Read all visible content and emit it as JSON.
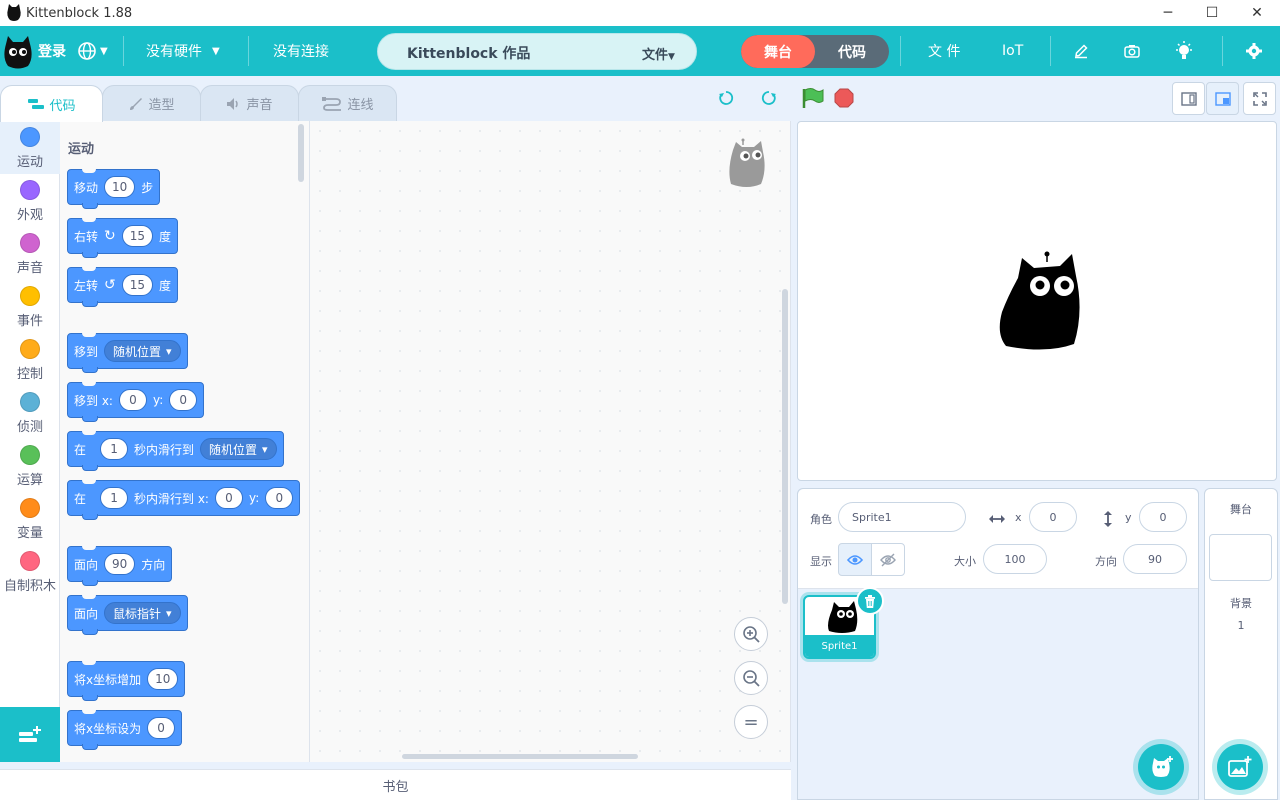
{
  "window": {
    "title": "Kittenblock 1.88",
    "minimize": "─",
    "maximize": "☐",
    "close": "✕"
  },
  "menubar": {
    "login": "登录",
    "hardware": "没有硬件",
    "connection": "没有连接",
    "project_title": "Kittenblock 作品",
    "file_dropdown": "文件",
    "mode_stage": "舞台",
    "mode_code": "代码",
    "file": "文 件",
    "iot": "IoT"
  },
  "tabs": {
    "code": "代码",
    "costume": "造型",
    "sound": "声音",
    "wiring": "连线"
  },
  "categories": [
    {
      "label": "运动",
      "color": "#4c97ff"
    },
    {
      "label": "外观",
      "color": "#9966ff"
    },
    {
      "label": "声音",
      "color": "#cf63cf"
    },
    {
      "label": "事件",
      "color": "#ffbf00"
    },
    {
      "label": "控制",
      "color": "#ffab19"
    },
    {
      "label": "侦测",
      "color": "#5cb1d6"
    },
    {
      "label": "运算",
      "color": "#59c059"
    },
    {
      "label": "变量",
      "color": "#ff8c1a"
    },
    {
      "label": "自制积木",
      "color": "#ff6680"
    }
  ],
  "palette": {
    "section_title": "运动",
    "move": {
      "label": "移动",
      "steps": "10",
      "unit": "步"
    },
    "turn_right": {
      "label": "右转",
      "icon": "rotate-clockwise-icon",
      "degrees": "15",
      "unit": "度"
    },
    "turn_left": {
      "label": "左转",
      "icon": "rotate-counterclockwise-icon",
      "degrees": "15",
      "unit": "度"
    },
    "goto": {
      "label": "移到",
      "target": "随机位置"
    },
    "goto_xy": {
      "label": "移到 x:",
      "x": "0",
      "ylabel": "y:",
      "y": "0"
    },
    "glide_to": {
      "label": "在",
      "secs": "1",
      "mid": "秒内滑行到",
      "target": "随机位置"
    },
    "glide_xy": {
      "label": "在",
      "secs": "1",
      "mid": "秒内滑行到 x:",
      "x": "0",
      "ylabel": "y:",
      "y": "0"
    },
    "point_dir": {
      "label": "面向",
      "dir": "90",
      "unit": "方向"
    },
    "point_towards": {
      "label": "面向",
      "target": "鼠标指针"
    },
    "change_x": {
      "label": "将x坐标增加",
      "value": "10"
    },
    "set_x": {
      "label": "将x坐标设为",
      "value": "0"
    }
  },
  "zoom": {
    "in": "+",
    "out": "−",
    "reset": "="
  },
  "backpack": "书包",
  "sprite_info": {
    "sprite_label": "角色",
    "sprite_name": "Sprite1",
    "x_label": "x",
    "x": "0",
    "y_label": "y",
    "y": "0",
    "show_label": "显示",
    "size_label": "大小",
    "size": "100",
    "direction_label": "方向",
    "direction": "90"
  },
  "sprites": [
    {
      "name": "Sprite1"
    }
  ],
  "stage_selector": {
    "title": "舞台",
    "backdrops_label": "背景",
    "backdrops_count": "1"
  },
  "colors": {
    "brand": "#1bbfc9",
    "motion_block": "#4c97ff",
    "stage_active": "#ff6b5b"
  }
}
